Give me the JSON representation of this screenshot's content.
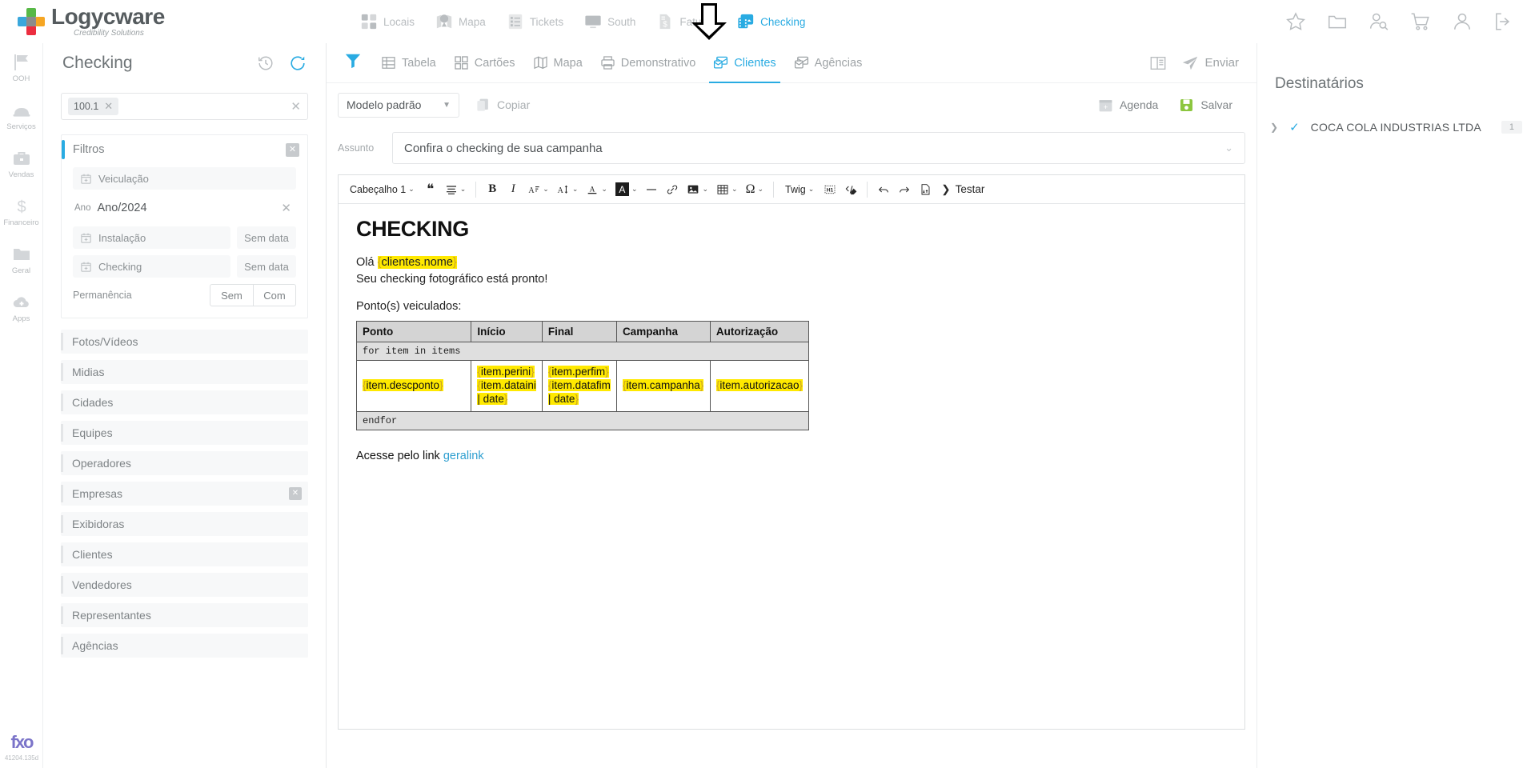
{
  "brand": {
    "name": "Logycware",
    "tagline": "Credibility Solutions"
  },
  "topnav": [
    {
      "label": "Locais",
      "icon": "grid-icon",
      "active": false
    },
    {
      "label": "Mapa",
      "icon": "map-pin-icon",
      "active": false
    },
    {
      "label": "Tickets",
      "icon": "checklist-icon",
      "active": false
    },
    {
      "label": "South",
      "icon": "monitor-icon",
      "active": false
    },
    {
      "label": "Faturas",
      "icon": "invoice-icon",
      "active": false
    },
    {
      "label": "Checking",
      "icon": "checking-icon",
      "active": true
    }
  ],
  "topicons": [
    {
      "name": "star-icon"
    },
    {
      "name": "folder-icon"
    },
    {
      "name": "user-search-icon"
    },
    {
      "name": "cart-icon"
    },
    {
      "name": "user-icon"
    },
    {
      "name": "logout-icon"
    }
  ],
  "rail": [
    {
      "label": "OOH",
      "icon": "flag-icon"
    },
    {
      "label": "Serviços",
      "icon": "hardhat-icon"
    },
    {
      "label": "Vendas",
      "icon": "briefcase-icon"
    },
    {
      "label": "Financeiro",
      "icon": "dollar-icon"
    },
    {
      "label": "Geral",
      "icon": "folder-icon"
    },
    {
      "label": "Apps",
      "icon": "cloud-plus-icon"
    }
  ],
  "rail_footer": {
    "logo": "fxo",
    "version": "41204.135d"
  },
  "sidebar": {
    "title": "Checking",
    "search": {
      "chip": "100.1",
      "chip_remove": "✕",
      "clear": "✕",
      "placeholder": ""
    },
    "filters": {
      "title": "Filtros",
      "close": "✕",
      "rows": [
        {
          "label": "Veiculação",
          "value": ""
        },
        {
          "label": "Instalação",
          "value": "Sem data"
        },
        {
          "label": "Checking",
          "value": "Sem data"
        }
      ],
      "year": {
        "label": "Ano",
        "value": "Ano/2024",
        "remove": "✕"
      },
      "permanence": {
        "label": "Permanência",
        "options": [
          "Sem",
          "Com"
        ]
      }
    },
    "items": [
      {
        "label": "Fotos/Vídeos",
        "has_close": false
      },
      {
        "label": "Midias",
        "has_close": false
      },
      {
        "label": "Cidades",
        "has_close": false
      },
      {
        "label": "Equipes",
        "has_close": false
      },
      {
        "label": "Operadores",
        "has_close": false
      },
      {
        "label": "Empresas",
        "has_close": true
      },
      {
        "label": "Exibidoras",
        "has_close": false
      },
      {
        "label": "Clientes",
        "has_close": false
      },
      {
        "label": "Vendedores",
        "has_close": false
      },
      {
        "label": "Representantes",
        "has_close": false
      },
      {
        "label": "Agências",
        "has_close": false
      }
    ],
    "item_close": "✕"
  },
  "tabs": [
    {
      "label": "Tabela",
      "icon": "table-icon",
      "active": false
    },
    {
      "label": "Cartões",
      "icon": "cards-icon",
      "active": false
    },
    {
      "label": "Mapa",
      "icon": "map-icon",
      "active": false
    },
    {
      "label": "Demonstrativo",
      "icon": "printer-icon",
      "active": false
    },
    {
      "label": "Clientes",
      "icon": "mail-clients-icon",
      "active": true
    },
    {
      "label": "Agências",
      "icon": "mail-agencies-icon",
      "active": false
    }
  ],
  "tabbar_right": {
    "layout_icon": "panel-layout-icon",
    "send_label": "Enviar",
    "send_icon": "paper-plane-icon"
  },
  "toolbar": {
    "template_select": "Modelo padrão",
    "copy_label": "Copiar",
    "agenda_label": "Agenda",
    "save_label": "Salvar"
  },
  "subject": {
    "label": "Assunto",
    "value": "Confira o checking de sua campanha"
  },
  "editor_toolbar": {
    "heading_select": "Cabeçalho 1",
    "twig_select": "Twig",
    "test_label": "Testar",
    "buttons": [
      "quote-icon",
      "align-icon",
      "bold-icon",
      "italic-icon",
      "font-size-icon",
      "line-height-icon",
      "text-color-icon",
      "highlight-icon",
      "horizontal-rule-icon",
      "link-icon",
      "image-icon",
      "table-icon",
      "special-char-icon",
      "h1-block-icon",
      "source-edit-icon",
      "undo-icon",
      "redo-icon",
      "page-break-icon"
    ]
  },
  "email": {
    "heading": "CHECKING",
    "greeting_prefix": "Olá ",
    "greeting_var": "clientes.nome",
    "line2": "Seu checking fotográfico está pronto!",
    "section_label": "Ponto(s) veiculados:",
    "table": {
      "headers": [
        "Ponto",
        "Início",
        "Final",
        "Campanha",
        "Autorização"
      ],
      "loop_open": "for item in items",
      "loop_close": "endfor",
      "row": {
        "ponto": "item.descponto",
        "inicio": [
          "item.perini",
          "item.dataini",
          "| date"
        ],
        "final": [
          "item.perfim",
          "item.datafim",
          "| date"
        ],
        "campanha": "item.campanha",
        "autorizacao": "item.autorizacao"
      }
    },
    "footer_prefix": "Acesse pelo link ",
    "footer_link": "geralink"
  },
  "recipients": {
    "title": "Destinatários",
    "rows": [
      {
        "name": "COCA COLA INDUSTRIAS LTDA",
        "count": "1",
        "checked": true
      }
    ]
  }
}
